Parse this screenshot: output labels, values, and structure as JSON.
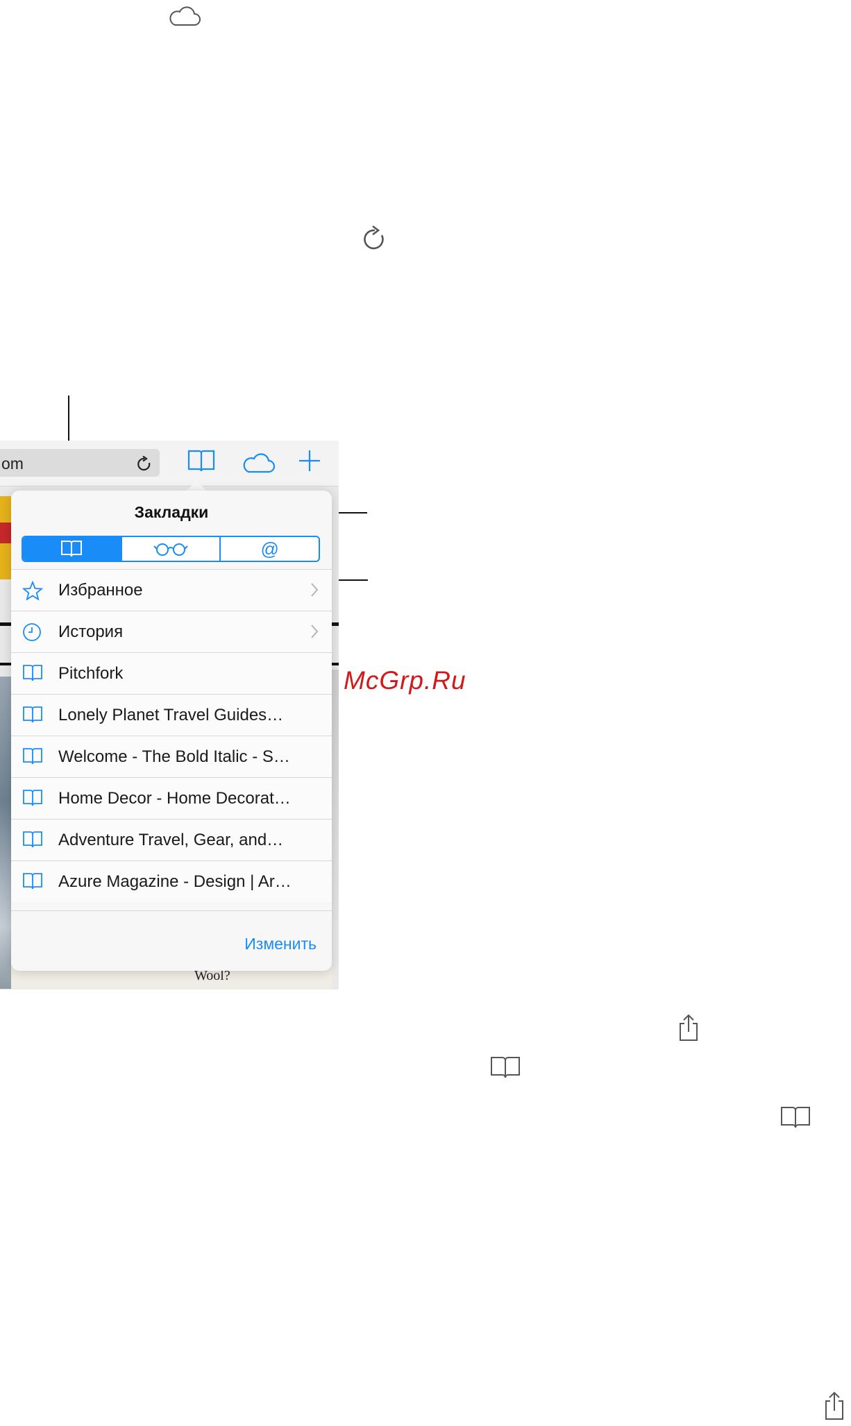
{
  "manual_icons": {
    "cloud_icon": "cloud-icon",
    "reload_icon": "reload-icon",
    "share_icon": "share-icon",
    "book_icon": "book-icon"
  },
  "screenshot": {
    "address_text": "om",
    "toolbar_icons": [
      "book-icon",
      "cloud-icon",
      "plus-icon"
    ],
    "popover": {
      "title": "Закладки",
      "segments": [
        {
          "icon": "book-icon",
          "active": true
        },
        {
          "icon": "glasses-icon",
          "active": false
        },
        {
          "label": "@",
          "active": false
        }
      ],
      "rows": [
        {
          "icon": "star-icon",
          "label": "Избранное",
          "chevron": true
        },
        {
          "icon": "clock-icon",
          "label": "История",
          "chevron": true
        },
        {
          "icon": "book-icon",
          "label": "Pitchfork",
          "chevron": false
        },
        {
          "icon": "book-icon",
          "label": "Lonely Planet Travel Guides…",
          "chevron": false
        },
        {
          "icon": "book-icon",
          "label": "Welcome - The Bold Italic - S…",
          "chevron": false
        },
        {
          "icon": "book-icon",
          "label": "Home Decor - Home Decorat…",
          "chevron": false
        },
        {
          "icon": "book-icon",
          "label": "Adventure Travel, Gear, and…",
          "chevron": false
        },
        {
          "icon": "book-icon",
          "label": "Azure Magazine - Design | Ar…",
          "chevron": false
        }
      ],
      "edit_label": "Изменить"
    },
    "background_text": "Wool?"
  },
  "watermark": "McGrp.Ru",
  "colors": {
    "accent": "#1a8cf7",
    "watermark": "#d11919"
  }
}
